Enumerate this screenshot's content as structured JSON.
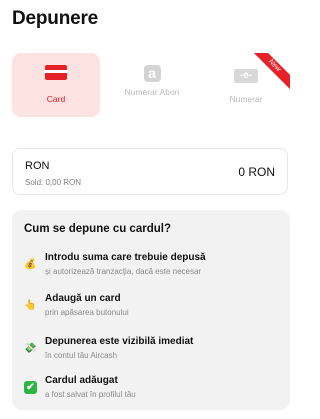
{
  "page": {
    "title": "Depunere"
  },
  "methods": [
    {
      "label": "Card",
      "icon": "card-icon",
      "selected": true
    },
    {
      "label": "Numerar Abon",
      "icon": "abon-icon",
      "icon_glyph": "a",
      "selected": false
    },
    {
      "label": "Numerar",
      "icon": "cash-icon",
      "icon_glyph": "-e-",
      "badge": "New",
      "selected": false
    }
  ],
  "amount": {
    "currency": "RON",
    "balance": "Sold: 0,00 RON",
    "value": "0 RON"
  },
  "info": {
    "title": "Cum se depune cu cardul?",
    "steps": [
      {
        "icon": "money-bag-icon",
        "glyph": "💰",
        "title": "Introdu suma care trebuie depusă",
        "subtitle": "și autorizează tranzacția, dacă este necesar"
      },
      {
        "icon": "hand-tap-icon",
        "glyph": "👆",
        "title": "Adaugă un card",
        "subtitle": "prin apăsarea butonului"
      },
      {
        "icon": "flying-money-icon",
        "glyph": "💸",
        "title": "Depunerea este vizibilă imediat",
        "subtitle": "în contul tău Aircash"
      },
      {
        "icon": "check-mark-icon",
        "glyph": "✔",
        "title": "Cardul adăugat",
        "subtitle": "a fost salvat în profilul tău"
      }
    ]
  },
  "colors": {
    "accent": "#e52227",
    "selected_bg": "#fde2e2",
    "panel_bg": "#f2f2f2",
    "check_green": "#2fb544"
  }
}
